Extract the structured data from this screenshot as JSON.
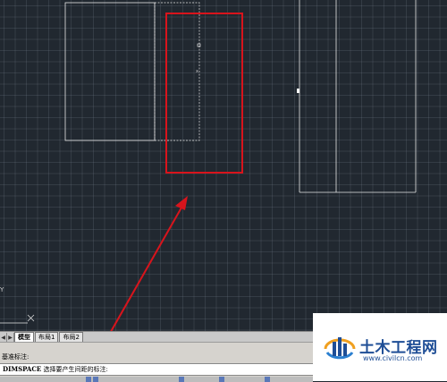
{
  "layout_tabs": [
    {
      "label": "模型",
      "active": true
    },
    {
      "label": "布局1",
      "active": false
    },
    {
      "label": "布局2",
      "active": false
    }
  ],
  "command": {
    "history_line": "基准标注:",
    "current_command": "DIMSPACE",
    "current_prompt": "选择要产生间距的标注:"
  },
  "watermark": {
    "name": "土木工程网",
    "url": "www.civilcn.com"
  },
  "colors": {
    "canvas_background": "#212830",
    "annotation_red": "#d8141c",
    "watermark_blue": "#1f4e96"
  }
}
